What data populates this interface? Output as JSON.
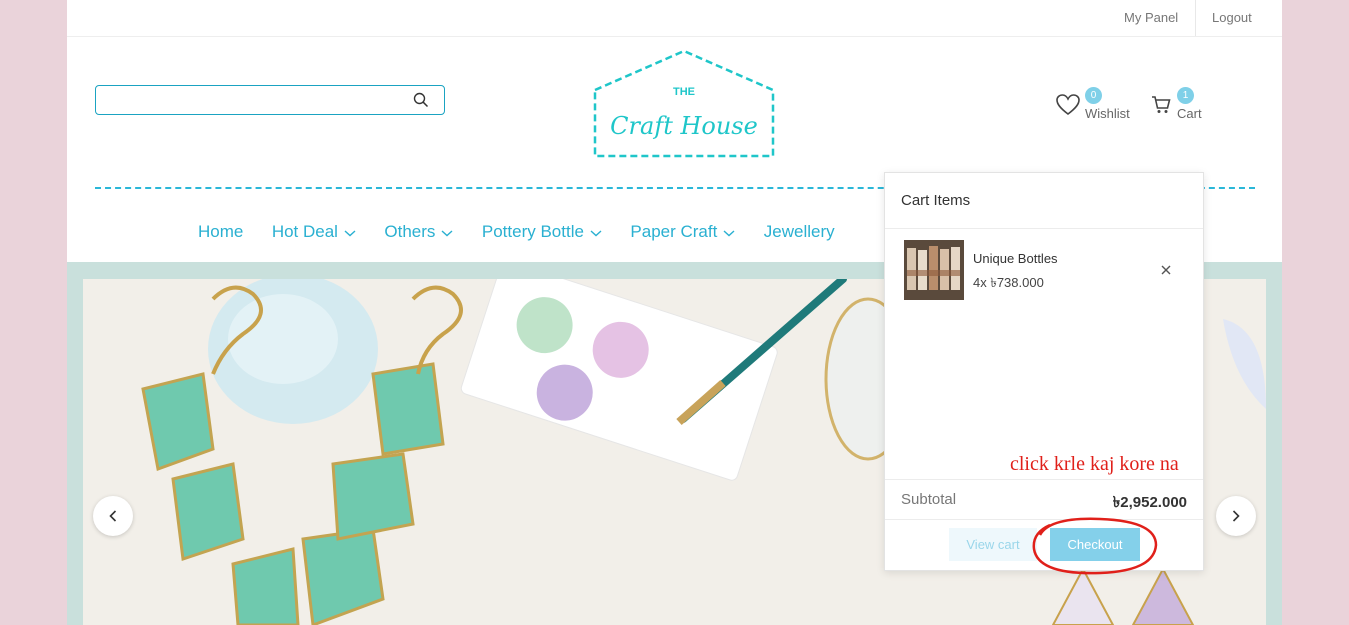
{
  "topbar": {
    "my_panel": "My Panel",
    "logout": "Logout"
  },
  "header": {
    "search_placeholder": "",
    "logo": {
      "line1": "THE",
      "line2": "Craft House"
    },
    "wishlist": {
      "count": "0",
      "label": "Wishlist"
    },
    "cart": {
      "count": "1",
      "label": "Cart"
    }
  },
  "nav": {
    "items": [
      {
        "label": "Home",
        "has_dropdown": false
      },
      {
        "label": "Hot Deal",
        "has_dropdown": true
      },
      {
        "label": "Others",
        "has_dropdown": true
      },
      {
        "label": "Pottery Bottle",
        "has_dropdown": true
      },
      {
        "label": "Paper Craft",
        "has_dropdown": true
      },
      {
        "label": "Jewellery",
        "has_dropdown": false
      }
    ]
  },
  "cart_dropdown": {
    "title": "Cart Items",
    "items": [
      {
        "name": "Unique Bottles",
        "qty_price": "4x ৳738.000"
      }
    ],
    "subtotal_label": "Subtotal",
    "subtotal_value": "৳2,952.000",
    "view_cart": "View cart",
    "checkout": "Checkout"
  },
  "annotation": {
    "text": "click krle kaj kore na",
    "color": "#e0201a"
  },
  "colors": {
    "accent": "#2ab7d8",
    "page_bg": "#ead3da",
    "hero_bg": "#c9e0dc"
  }
}
